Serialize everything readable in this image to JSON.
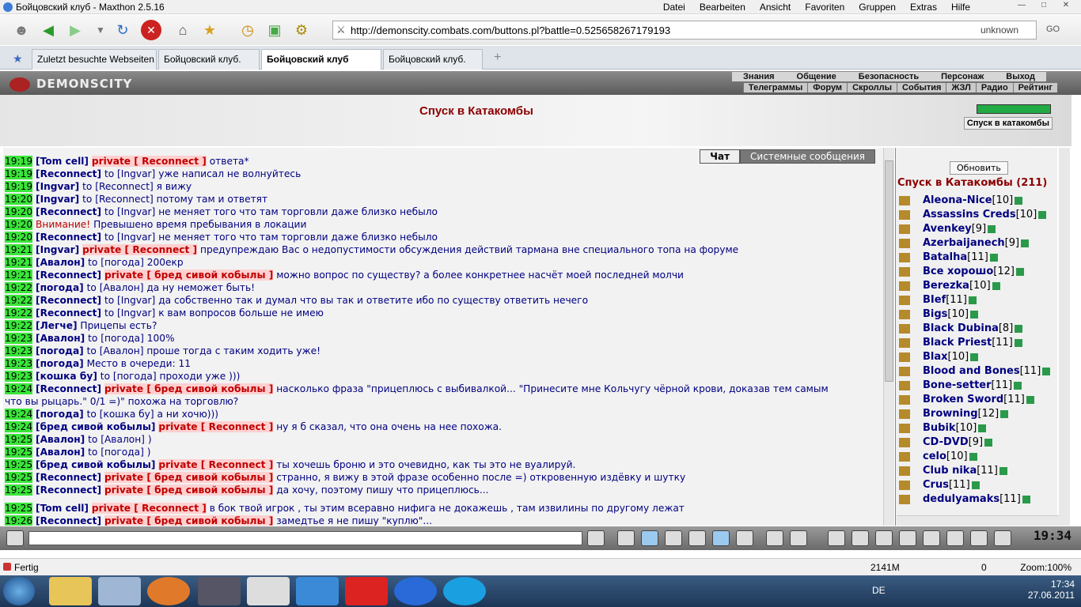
{
  "window": {
    "title": "Бойцовский клуб - Maxthon 2.5.16",
    "menu": [
      "Datei",
      "Bearbeiten",
      "Ansicht",
      "Favoriten",
      "Gruppen",
      "Extras",
      "Hilfe"
    ]
  },
  "address": {
    "url": "http://demonscity.combats.com/buttons.pl?battle=0.525658267179193",
    "security": "unknown",
    "go": "GO"
  },
  "tabs": [
    {
      "label": "Zuletzt besuchte Webseiten"
    },
    {
      "label": "Бойцовский клуб."
    },
    {
      "label": "Бойцовский клуб"
    },
    {
      "label": "Бойцовский клуб."
    }
  ],
  "game": {
    "logo": "DEMONSCITY",
    "nav_top": [
      "Знания",
      "Общение",
      "Безопасность",
      "Персонаж",
      "Выход"
    ],
    "nav_bottom": [
      "Телеграммы",
      "Форум",
      "Скроллы",
      "События",
      "ЖЗЛ",
      "Радио",
      "Рейтинг"
    ],
    "location": "Спуск в Катакомбы",
    "go_button": "Спуск в катакомбы"
  },
  "chat": {
    "tabs": [
      "Чат",
      "Системные сообщения"
    ],
    "lines": [
      {
        "t": "19:19",
        "n": "[Tom cell]",
        "p": "private [ Reconnect ]",
        "m": "ответа*"
      },
      {
        "t": "19:19",
        "n": "[Reconnect]",
        "to": "to [Ingvar]",
        "m": "уже написал не волнуйтесь"
      },
      {
        "t": "19:19",
        "n": "[Ingvar]",
        "to": "to [Reconnect]",
        "m": "я вижу"
      },
      {
        "t": "19:20",
        "n": "[Ingvar]",
        "to": "to [Reconnect]",
        "m": "потому там и ответят"
      },
      {
        "t": "19:20",
        "n": "[Reconnect]",
        "to": "to [Ingvar]",
        "m": "не меняет того что там торговли даже близко небыло"
      },
      {
        "t": "19:20",
        "s": "Внимание!",
        "m": "Превышено время пребывания в локации"
      },
      {
        "t": "19:20",
        "n": "[Reconnect]",
        "to": "to [Ingvar]",
        "m": "не меняет того что там торговли даже близко небыло"
      },
      {
        "t": "19:21",
        "n": "[Ingvar]",
        "p": "private [ Reconnect ]",
        "m": "предупреждаю Вас о недопустимости обсуждения действий тармана вне специального топа на форуме"
      },
      {
        "t": "19:21",
        "n": "[Авалон]",
        "to": "to [погода]",
        "m": "200екр"
      },
      {
        "t": "19:21",
        "n": "[Reconnect]",
        "p": "private [ бред сивой кобылы ]",
        "m": "можно вопрос по существу? а более конкретнее насчёт моей последней молчи"
      },
      {
        "t": "19:22",
        "n": "[погода]",
        "to": "to [Авалон]",
        "m": "да ну неможет быть!"
      },
      {
        "t": "19:22",
        "n": "[Reconnect]",
        "to": "to [Ingvar]",
        "m": "да собственно так и думал что вы так и ответите ибо по существу ответить нечего"
      },
      {
        "t": "19:22",
        "n": "[Reconnect]",
        "to": "to [Ingvar]",
        "m": "к вам вопросов больше не имею"
      },
      {
        "t": "19:22",
        "n": "[Легче]",
        "m": "Прицепы есть?"
      },
      {
        "t": "19:23",
        "n": "[Авалон]",
        "to": "to [погода]",
        "m": "100%"
      },
      {
        "t": "19:23",
        "n": "[погода]",
        "to": "to [Авалон]",
        "m": "проше тогда с таким ходить уже!"
      },
      {
        "t": "19:23",
        "n": "[погода]",
        "m": "Место в очереди: 11"
      },
      {
        "t": "19:23",
        "n": "[кошка бу]",
        "to": "to [погода]",
        "m": "проходи уже )))"
      },
      {
        "t": "19:24",
        "n": "[Reconnect]",
        "p": "private [ бред сивой кобылы ]",
        "m": "насколько фраза \"прицеплюсь с выбивалкой... \"Принесите мне Кольчугу чёрной крови, доказав тем самым"
      },
      {
        "m2": "что вы рыцарь.\" 0/1 =)\" похожа на торговлю?"
      },
      {
        "t": "19:24",
        "n": "[погода]",
        "to": "to [кошка бу]",
        "m": "а ни хочю)))"
      },
      {
        "t": "19:24",
        "n": "[бред сивой кобылы]",
        "p": "private [ Reconnect ]",
        "m": "ну я б сказал, что она очень на нее похожа."
      },
      {
        "t": "19:25",
        "n": "[Авалон]",
        "to": "to [Авалон]",
        "m": ")"
      },
      {
        "t": "19:25",
        "n": "[Авалон]",
        "to": "to [погода]",
        "m": ")"
      },
      {
        "t": "19:25",
        "n": "[бред сивой кобылы]",
        "p": "private [ Reconnect ]",
        "m": "ты хочешь броню и это очевидно, как ты это не вуалируй."
      },
      {
        "t": "19:25",
        "n": "[Reconnect]",
        "p": "private [ бред сивой кобылы ]",
        "m": "странно, я вижу в этой фразе особенно после =) откровенную издёвку и шутку"
      },
      {
        "t": "19:25",
        "n": "[Reconnect]",
        "p": "private [ бред сивой кобылы ]",
        "m": "да хочу, поэтому пишу что прицеплюсь..."
      },
      {
        "t": "19:25",
        "n": "[Tom cell]",
        "p": "private [ Reconnect ]",
        "m": "в бок твой игрок , ты этим всеравно нифига не докажешь , там извилины по другому лежат"
      },
      {
        "t": "19:26",
        "n": "[Reconnect]",
        "p": "private [ бред сивой кобылы ]",
        "m": "замедтье я не пишу \"куплю\"..."
      }
    ]
  },
  "side": {
    "refresh": "Обновить",
    "title": "Спуск в Катакомбы (211)",
    "players": [
      {
        "n": "Aleona-Nice",
        "l": "[10]"
      },
      {
        "n": "Assassins Creds",
        "l": "[10]"
      },
      {
        "n": "Avenkey",
        "l": "[9]"
      },
      {
        "n": "Azerbaijanech",
        "l": "[9]"
      },
      {
        "n": "Batalha",
        "l": "[11]"
      },
      {
        "n": "Все хорошо",
        "l": "[12]"
      },
      {
        "n": "Berezka",
        "l": "[10]"
      },
      {
        "n": "BIef",
        "l": "[11]"
      },
      {
        "n": "Bigs",
        "l": "[10]"
      },
      {
        "n": "Black Dubina",
        "l": "[8]"
      },
      {
        "n": "Black Priest",
        "l": "[11]"
      },
      {
        "n": "Blax",
        "l": "[10]"
      },
      {
        "n": "Blood and Bones",
        "l": "[11]"
      },
      {
        "n": "Bone-setter",
        "l": "[11]"
      },
      {
        "n": "Broken Sword",
        "l": "[11]"
      },
      {
        "n": "Browning",
        "l": "[12]"
      },
      {
        "n": "Bubik",
        "l": "[10]"
      },
      {
        "n": "CD-DVD",
        "l": "[9]"
      },
      {
        "n": "celo",
        "l": "[10]"
      },
      {
        "n": "Club nika",
        "l": "[11]"
      },
      {
        "n": "Crus",
        "l": "[11]"
      },
      {
        "n": "dedulyamaks",
        "l": "[11]"
      }
    ]
  },
  "clock": "19:34",
  "status": {
    "state": "Fertig",
    "mem": "2141M",
    "zoom": "Zoom:100%",
    "count": "0"
  },
  "taskbar": {
    "lang": "DE",
    "time": "17:34",
    "date": "27.06.2011"
  }
}
